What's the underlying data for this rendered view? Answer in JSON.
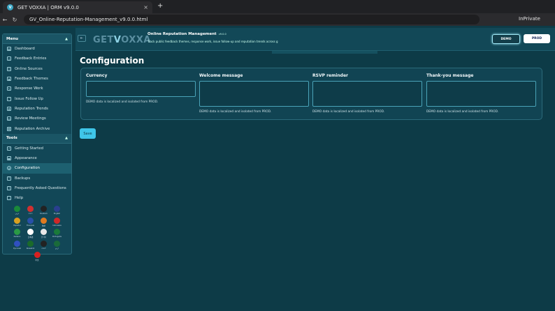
{
  "browser": {
    "tab_favicon": "V",
    "tab_title": "GET VOXXA | ORM v9.0.0",
    "tab_close": "×",
    "new_tab": "+",
    "back": "←",
    "refresh": "↻",
    "url": "GV_Online-Reputation-Management_v9.0.0.html",
    "inprivate": "InPrivate"
  },
  "sidebar": {
    "menu_label": "Menu",
    "menu_items": [
      {
        "label": "Dashboard",
        "icon": "grid-icon"
      },
      {
        "label": "Feedback Entries",
        "icon": "list-icon"
      },
      {
        "label": "Online Sources",
        "icon": "globe-icon"
      },
      {
        "label": "Feedback Themes",
        "icon": "tag-icon"
      },
      {
        "label": "Response Work",
        "icon": "edit-icon"
      },
      {
        "label": "Issue Follow Up",
        "icon": "check-icon"
      },
      {
        "label": "Reputation Trends",
        "icon": "chart-icon"
      },
      {
        "label": "Review Meetings",
        "icon": "calendar-icon"
      },
      {
        "label": "Reputation Archive",
        "icon": "archive-icon"
      }
    ],
    "tools_label": "Tools",
    "tools_items": [
      {
        "label": "Getting Started",
        "icon": "rocket-icon"
      },
      {
        "label": "Appearance",
        "icon": "palette-icon"
      },
      {
        "label": "Configuration",
        "icon": "gear-icon"
      },
      {
        "label": "Backups",
        "icon": "upload-icon"
      },
      {
        "label": "Frequently Asked Questions",
        "icon": "question-icon"
      },
      {
        "label": "Help",
        "icon": "help-icon"
      }
    ],
    "languages": [
      {
        "label": "عربي",
        "color": "#1a8a3a"
      },
      {
        "label": "বাংলা",
        "color": "#d03030"
      },
      {
        "label": "Deutsch",
        "color": "#222222"
      },
      {
        "label": "English",
        "color": "#2a3f8f"
      },
      {
        "label": "Español",
        "color": "#d8a020"
      },
      {
        "label": "Français",
        "color": "#2850a8"
      },
      {
        "label": "हिन्दी",
        "color": "#e07a20"
      },
      {
        "label": "Indonesia",
        "color": "#d02828"
      },
      {
        "label": "Italiano",
        "color": "#2a9a45"
      },
      {
        "label": "日本語",
        "color": "#ffffff"
      },
      {
        "label": "한국어",
        "color": "#e8e8e8"
      },
      {
        "label": "Português",
        "color": "#1a7a3a"
      },
      {
        "label": "Русский",
        "color": "#3050c0"
      },
      {
        "label": "Kiswahili",
        "color": "#1a6a2a"
      },
      {
        "label": "ትግርኛ",
        "color": "#222222"
      },
      {
        "label": "اردو",
        "color": "#1a6a3a"
      },
      {
        "label": "中文",
        "color": "#d82020"
      }
    ]
  },
  "header": {
    "collapse_icon": "⇤",
    "logo_a": "GET",
    "logo_v": "V",
    "logo_b": "OXXA",
    "title": "Online Reputation Management",
    "version": "v9.0.0",
    "subtitle": "Track public feedback themes, response work, issue follow-up and reputation trends across g",
    "demo_label": "DEMO",
    "prod_label": "PROD"
  },
  "main": {
    "page_title": "Configuration",
    "fields": [
      {
        "label": "Currency",
        "value": "",
        "help": "DEMO data is localized and isolated from PROD."
      },
      {
        "label": "Welcome message",
        "value": "",
        "help": "DEMO data is localized and isolated from PROD."
      },
      {
        "label": "RSVP reminder",
        "value": "",
        "help": "DEMO data is localized and isolated from PROD."
      },
      {
        "label": "Thank-you message",
        "value": "",
        "help": "DEMO data is localized and isolated from PROD."
      }
    ],
    "save_label": "Save"
  }
}
